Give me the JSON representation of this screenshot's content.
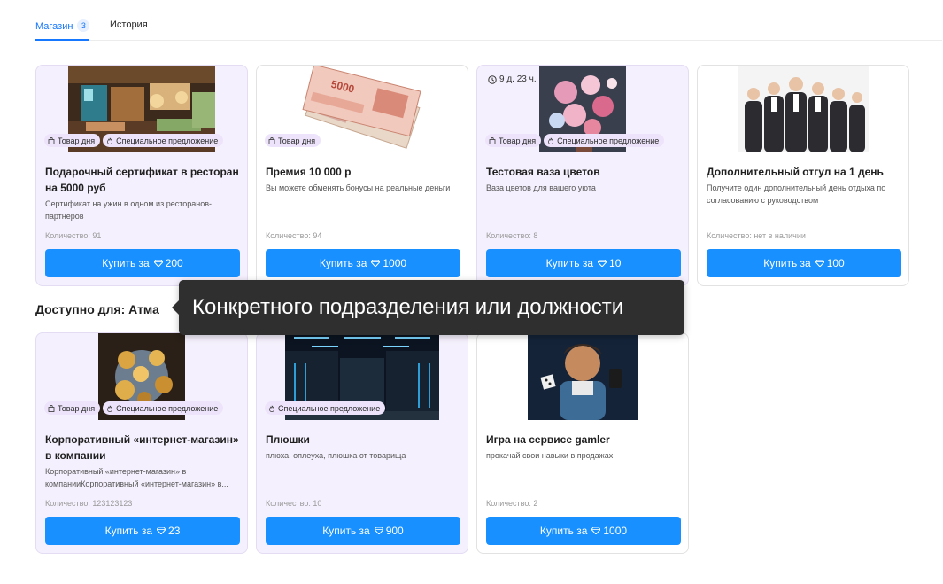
{
  "tabs": [
    {
      "label": "Магазин",
      "badge": "3",
      "active": true
    },
    {
      "label": "История",
      "active": false
    }
  ],
  "cards_top": [
    {
      "title": "Подарочный сертификат в ресторан на 5000 руб",
      "description": "Сертификат на ужин в одном из ресторанов-партнеров",
      "quantity": "Количество: 91",
      "button_prefix": "Купить за",
      "price": "200",
      "badges": [
        "Товар дня",
        "Специальное предложение"
      ],
      "image": "restaurant-photo"
    },
    {
      "title": "Премия 10 000 р",
      "description": "Вы можете обменять бонусы на реальные деньги",
      "quantity": "Количество: 94",
      "button_prefix": "Купить за",
      "price": "1000",
      "badges": [
        "Товар дня"
      ],
      "image": "banknotes-photo"
    },
    {
      "title": "Тестовая ваза цветов",
      "description": "Ваза цветов для вашего уюта",
      "quantity": "Количество: 8",
      "button_prefix": "Купить за",
      "price": "10",
      "badges": [
        "Товар дня",
        "Специальное предложение"
      ],
      "timer": "9 д. 23 ч.",
      "image": "flowers-photo"
    },
    {
      "title": "Дополнительный отгул на 1 день",
      "description": "Получите один дополнительный день отдыха по согласованию с руководством",
      "quantity": "Количество: нет в наличии",
      "button_prefix": "Купить за",
      "price": "100",
      "badges": [],
      "image": "business-team-photo"
    }
  ],
  "section": {
    "title": "Доступно для: Атма"
  },
  "tooltip": {
    "text": "Конкретного подразделения или должности"
  },
  "cards_bottom": [
    {
      "title": "Корпоративный «интернет-магазин» в компании",
      "description": "Корпоративный «интернет-магазин» в компанииКорпоративный «интернет-магазин» в...",
      "quantity": "Количество: 123123123",
      "button_prefix": "Купить за",
      "price": "23",
      "badges": [
        "Товар дня",
        "Специальное предложение"
      ],
      "image": "crypto-coins-photo"
    },
    {
      "title": "Плюшки",
      "description": "плюха, оплеуха, плюшка от товарища",
      "quantity": "Количество: 10",
      "button_prefix": "Купить за",
      "price": "900",
      "badges": [
        "Специальное предложение"
      ],
      "image": "server-room-photo"
    },
    {
      "title": "Игра на сервисе gamler",
      "description": "прокачай свои навыки в продажах",
      "quantity": "Количество: 2",
      "button_prefix": "Купить за",
      "price": "1000",
      "badges": [],
      "image": "gamer-character-photo"
    }
  ],
  "colors": {
    "accent": "#1890ff",
    "special_bg": "#f5f0fd",
    "badge_bg": "#ede4fb",
    "tooltip_bg": "#2f2f2f"
  }
}
